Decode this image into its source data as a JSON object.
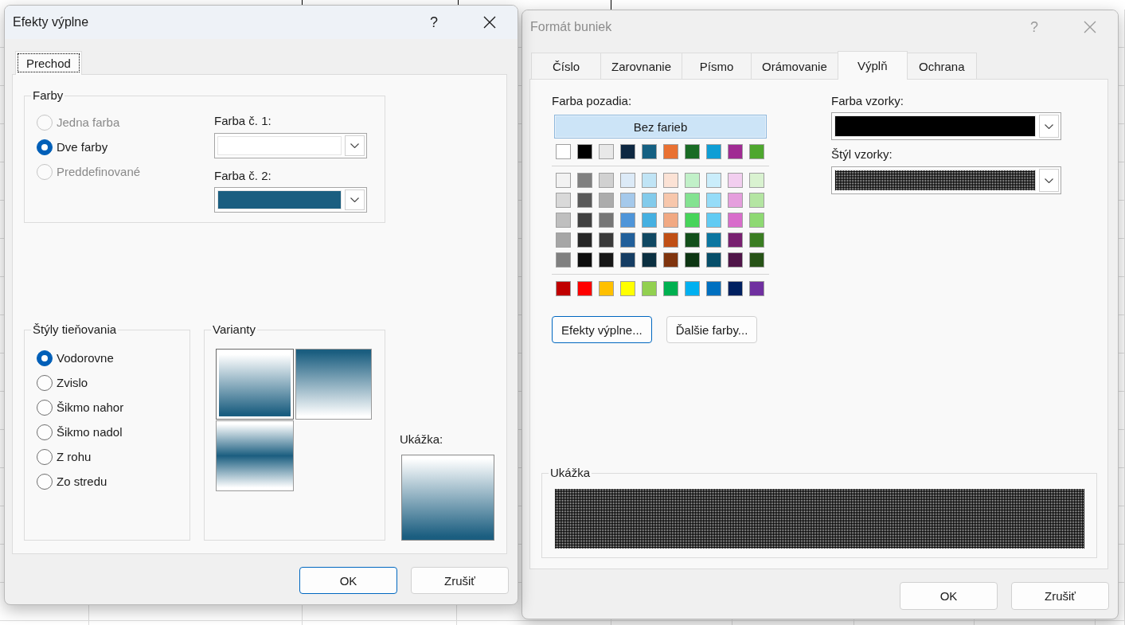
{
  "fill_effects": {
    "title": "Efekty výplne",
    "help": "?",
    "active": true,
    "tabs": [
      {
        "label": "Prechod",
        "selected": true,
        "focused": true
      }
    ],
    "colors_group": {
      "label": "Farby",
      "options": [
        {
          "label": "Jedna farba",
          "selected": false,
          "disabled": true
        },
        {
          "label": "Dve farby",
          "selected": true,
          "disabled": false
        },
        {
          "label": "Preddefinované",
          "selected": false,
          "disabled": true
        }
      ]
    },
    "color_1": {
      "label": "Farba č. 1:",
      "color": "#ffffff"
    },
    "color_2": {
      "label": "Farba č. 2:",
      "color": "#1b5e80"
    },
    "shading_group": {
      "label": "Štýly tieňovania",
      "options": [
        {
          "label": "Vodorovne",
          "selected": true
        },
        {
          "label": "Zvislo",
          "selected": false
        },
        {
          "label": "Šikmo nahor",
          "selected": false
        },
        {
          "label": "Šikmo nadol",
          "selected": false
        },
        {
          "label": "Z rohu",
          "selected": false
        },
        {
          "label": "Zo stredu",
          "selected": false
        }
      ]
    },
    "variants_group": {
      "label": "Varianty",
      "variants": [
        {
          "kind": "light_to_dark",
          "selected": true
        },
        {
          "kind": "dark_to_light",
          "selected": false
        },
        {
          "kind": "light_dark_light",
          "selected": false
        }
      ]
    },
    "preview": {
      "label": "Ukážka:"
    },
    "buttons": [
      {
        "label": "OK",
        "default": true
      },
      {
        "label": "Zrušiť",
        "default": false
      }
    ]
  },
  "format_cells": {
    "title": "Formát buniek",
    "help": "?",
    "active": false,
    "tabs": [
      {
        "label": "Číslo",
        "selected": false,
        "focused": false
      },
      {
        "label": "Zarovnanie",
        "selected": false,
        "focused": false
      },
      {
        "label": "Písmo",
        "selected": false,
        "focused": false
      },
      {
        "label": "Orámovanie",
        "selected": false,
        "focused": false
      },
      {
        "label": "Výplň",
        "selected": true,
        "focused": false
      },
      {
        "label": "Ochrana",
        "selected": false,
        "focused": false
      }
    ],
    "background": {
      "label": "Farba pozadia:",
      "no_color": {
        "label": "Bez farieb",
        "selected": true
      },
      "theme_row": [
        {
          "color": "#ffffff",
          "selected": false
        },
        {
          "color": "#000000",
          "selected": false
        },
        {
          "color": "#e8e8e8",
          "selected": false
        },
        {
          "color": "#0e2841",
          "selected": false
        },
        {
          "color": "#156082",
          "selected": false
        },
        {
          "color": "#e97132",
          "selected": false
        },
        {
          "color": "#196b24",
          "selected": false
        },
        {
          "color": "#0f9ed5",
          "selected": false
        },
        {
          "color": "#a02b93",
          "selected": false
        },
        {
          "color": "#4ea72e",
          "selected": false
        }
      ],
      "tint_rows": [
        [
          {
            "color": "#f2f2f2",
            "selected": false
          },
          {
            "color": "#808080",
            "selected": false
          },
          {
            "color": "#d1d1d1",
            "selected": false
          },
          {
            "color": "#dceaf7",
            "selected": false
          },
          {
            "color": "#c0e4f5",
            "selected": false
          },
          {
            "color": "#fbe2d5",
            "selected": false
          },
          {
            "color": "#c1f0c8",
            "selected": false
          },
          {
            "color": "#caedfb",
            "selected": false
          },
          {
            "color": "#f2ceef",
            "selected": false
          },
          {
            "color": "#d9f2d0",
            "selected": false
          }
        ],
        [
          {
            "color": "#d9d9d9",
            "selected": false
          },
          {
            "color": "#595959",
            "selected": false
          },
          {
            "color": "#acacac",
            "selected": false
          },
          {
            "color": "#a5c9eb",
            "selected": false
          },
          {
            "color": "#83cbeb",
            "selected": false
          },
          {
            "color": "#f7c7ac",
            "selected": false
          },
          {
            "color": "#84e291",
            "selected": false
          },
          {
            "color": "#95dcf8",
            "selected": false
          },
          {
            "color": "#e59edd",
            "selected": false
          },
          {
            "color": "#b4e5a2",
            "selected": false
          }
        ],
        [
          {
            "color": "#bfbfbf",
            "selected": false
          },
          {
            "color": "#404040",
            "selected": false
          },
          {
            "color": "#767676",
            "selected": false
          },
          {
            "color": "#4e95d9",
            "selected": false
          },
          {
            "color": "#45b0e1",
            "selected": false
          },
          {
            "color": "#f1a983",
            "selected": false
          },
          {
            "color": "#47d45a",
            "selected": false
          },
          {
            "color": "#61cbf3",
            "selected": false
          },
          {
            "color": "#d86dcb",
            "selected": false
          },
          {
            "color": "#8ed973",
            "selected": false
          }
        ],
        [
          {
            "color": "#a6a6a6",
            "selected": false
          },
          {
            "color": "#262626",
            "selected": false
          },
          {
            "color": "#3a3a3a",
            "selected": false
          },
          {
            "color": "#215f9a",
            "selected": false
          },
          {
            "color": "#104862",
            "selected": false
          },
          {
            "color": "#c04f15",
            "selected": false
          },
          {
            "color": "#124f1a",
            "selected": false
          },
          {
            "color": "#0b76a0",
            "selected": false
          },
          {
            "color": "#782070",
            "selected": false
          },
          {
            "color": "#3a7d22",
            "selected": false
          }
        ],
        [
          {
            "color": "#808080",
            "selected": false
          },
          {
            "color": "#0d0d0d",
            "selected": false
          },
          {
            "color": "#171717",
            "selected": false
          },
          {
            "color": "#153d63",
            "selected": false
          },
          {
            "color": "#0b3041",
            "selected": false
          },
          {
            "color": "#80340e",
            "selected": false
          },
          {
            "color": "#0d3512",
            "selected": false
          },
          {
            "color": "#074f6a",
            "selected": false
          },
          {
            "color": "#501549",
            "selected": false
          },
          {
            "color": "#275317",
            "selected": false
          }
        ]
      ],
      "standard_row": [
        {
          "color": "#c00000",
          "selected": false
        },
        {
          "color": "#ff0000",
          "selected": false
        },
        {
          "color": "#ffc000",
          "selected": false
        },
        {
          "color": "#ffff00",
          "selected": false
        },
        {
          "color": "#92d050",
          "selected": false
        },
        {
          "color": "#00b050",
          "selected": false
        },
        {
          "color": "#00b0f0",
          "selected": false
        },
        {
          "color": "#0070c0",
          "selected": false
        },
        {
          "color": "#002060",
          "selected": false
        },
        {
          "color": "#7030a0",
          "selected": false
        }
      ]
    },
    "actions": [
      {
        "label": "Efekty výplne...",
        "focused": true
      },
      {
        "label": "Ďalšie farby...",
        "focused": false
      }
    ],
    "pattern_color": {
      "label": "Farba vzorky:",
      "color": "#000000"
    },
    "pattern_style": {
      "label": "Štýl vzorky:",
      "kind": "dots_75"
    },
    "preview": {
      "label": "Ukážka"
    },
    "buttons": [
      {
        "label": "OK",
        "default": false
      },
      {
        "label": "Zrušiť",
        "default": false
      }
    ]
  }
}
